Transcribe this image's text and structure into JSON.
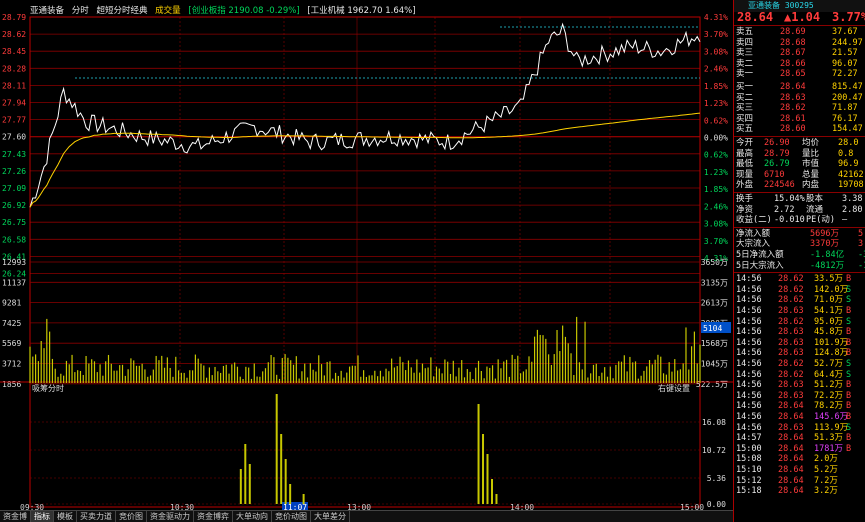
{
  "header": {
    "stock_name": "亚通装备",
    "view_mode": "分时",
    "indicator": "超短分时经典",
    "volume_label": "成交量",
    "index1": "[创业板指 2190.08 -0.29%]",
    "index2": "[工业机械 1962.70 1.64%]"
  },
  "price_axis": {
    "left": [
      "28.79",
      "28.62",
      "28.45",
      "28.28",
      "28.11",
      "27.94",
      "27.77",
      "27.60",
      "27.43",
      "27.26",
      "27.09",
      "26.92",
      "26.75",
      "26.58",
      "26.41",
      "26.24"
    ],
    "right": [
      "4.31%",
      "3.70%",
      "3.08%",
      "2.46%",
      "1.85%",
      "1.23%",
      "0.62%",
      "0.00%",
      "0.62%",
      "1.23%",
      "1.85%",
      "2.46%",
      "3.08%",
      "3.70%",
      "4.31%"
    ]
  },
  "volume_axis": {
    "left": [
      "12993",
      "11137",
      "9281",
      "7425",
      "5569",
      "3712",
      "1856"
    ],
    "right": [
      "3650万",
      "3135万",
      "2613万",
      "2090万",
      "1568万",
      "1045万",
      "522.5万"
    ],
    "current": "5104"
  },
  "sub_chart": {
    "title": "吸筹分时",
    "settings": "右键设置",
    "axis": [
      "16.08",
      "10.72",
      "5.36",
      "0.00"
    ]
  },
  "time_axis": [
    "09:30",
    "10:30",
    "11:07",
    "13:00",
    "14:00",
    "15:00"
  ],
  "bottom_tabs": [
    "资金博",
    "指标",
    "模板",
    "买卖力道",
    "竞价图",
    "资金驱动力",
    "资金博弈",
    "大单动向",
    "竞价动图",
    "大单差分"
  ],
  "panel": {
    "title": "亚通装备 300295",
    "last_price": "28.64",
    "change": "▲1.04",
    "pct": "3.77%",
    "asks": [
      {
        "label": "卖五",
        "price": "28.69",
        "vol": "37.67"
      },
      {
        "label": "卖四",
        "price": "28.68",
        "vol": "244.97"
      },
      {
        "label": "卖三",
        "price": "28.67",
        "vol": "21.57"
      },
      {
        "label": "卖二",
        "price": "28.66",
        "vol": "96.07"
      },
      {
        "label": "卖一",
        "price": "28.65",
        "vol": "72.27"
      }
    ],
    "bids": [
      {
        "label": "买一",
        "price": "28.64",
        "vol": "815.47"
      },
      {
        "label": "买二",
        "price": "28.63",
        "vol": "200.47"
      },
      {
        "label": "买三",
        "price": "28.62",
        "vol": "71.87"
      },
      {
        "label": "买四",
        "price": "28.61",
        "vol": "76.17"
      },
      {
        "label": "买五",
        "price": "28.60",
        "vol": "154.47"
      }
    ],
    "stats": [
      {
        "l1": "今开",
        "v1": "26.90",
        "l2": "均价",
        "v2": "28.0"
      },
      {
        "l1": "最高",
        "v1": "28.79",
        "l2": "量比",
        "v2": "0.8"
      },
      {
        "l1": "最低",
        "v1": "26.79",
        "l2": "市值",
        "v2": "96.9"
      },
      {
        "l1": "现量",
        "v1": "6710",
        "l2": "总量",
        "v2": "42162"
      },
      {
        "l1": "外盘",
        "v1": "224546",
        "l2": "内盘",
        "v2": "19708"
      }
    ],
    "stats2": [
      {
        "l1": "换手",
        "v1": "15.04%",
        "l2": "股本",
        "v2": "3.38"
      },
      {
        "l1": "净资",
        "v1": "2.72",
        "l2": "流通",
        "v2": "2.80"
      },
      {
        "l1": "收益(二)",
        "v1": "-0.010",
        "l2": "PE(动)",
        "v2": "—"
      }
    ],
    "flows": [
      {
        "label": "净流入额",
        "value": "5696万",
        "extra": "5"
      },
      {
        "label": "大宗流入",
        "value": "3370万",
        "extra": "3"
      },
      {
        "label": "5日净流入额",
        "value": "-1.84亿",
        "extra": "-3"
      },
      {
        "label": "5日大宗流入",
        "value": "-4812万",
        "extra": "-1"
      }
    ],
    "ticks": [
      {
        "t": "14:56",
        "p": "28.62",
        "v": "33.5万",
        "s": "B"
      },
      {
        "t": "14:56",
        "p": "28.62",
        "v": "142.0万",
        "s": "S"
      },
      {
        "t": "14:56",
        "p": "28.62",
        "v": "71.0万",
        "s": "S"
      },
      {
        "t": "14:56",
        "p": "28.63",
        "v": "54.1万",
        "s": "B"
      },
      {
        "t": "14:56",
        "p": "28.62",
        "v": "95.0万",
        "s": "S"
      },
      {
        "t": "14:56",
        "p": "28.63",
        "v": "45.8万",
        "s": "B"
      },
      {
        "t": "14:56",
        "p": "28.63",
        "v": "101.9万",
        "s": "B"
      },
      {
        "t": "14:56",
        "p": "28.63",
        "v": "124.8万",
        "s": "B"
      },
      {
        "t": "14:56",
        "p": "28.62",
        "v": "52.7万",
        "s": "S"
      },
      {
        "t": "14:56",
        "p": "28.62",
        "v": "64.4万",
        "s": "S"
      },
      {
        "t": "14:56",
        "p": "28.63",
        "v": "51.2万",
        "s": "B"
      },
      {
        "t": "14:56",
        "p": "28.63",
        "v": "72.2万",
        "s": "B"
      },
      {
        "t": "14:56",
        "p": "28.64",
        "v": "78.2万",
        "s": "B"
      },
      {
        "t": "14:56",
        "p": "28.64",
        "v": "145.6万",
        "s": "B"
      },
      {
        "t": "14:56",
        "p": "28.63",
        "v": "113.9万",
        "s": "S"
      },
      {
        "t": "14:57",
        "p": "28.64",
        "v": "51.3万",
        "s": "B"
      },
      {
        "t": "15:00",
        "p": "28.64",
        "v": "1781万",
        "s": "B"
      },
      {
        "t": "15:08",
        "p": "28.64",
        "v": "2.0万",
        "s": ""
      },
      {
        "t": "15:10",
        "p": "28.64",
        "v": "5.2万",
        "s": ""
      },
      {
        "t": "15:12",
        "p": "28.64",
        "v": "7.2万",
        "s": ""
      },
      {
        "t": "15:18",
        "p": "28.64",
        "v": "3.2万",
        "s": ""
      }
    ]
  },
  "colors": {
    "up": "#ff3b3b",
    "down": "#00d65a",
    "grid": "#8a0000",
    "price_line": "#ffffff",
    "avg_line": "#ffd200",
    "vol_bar": "#c8c800",
    "sub_bar": "#c8c800"
  }
}
